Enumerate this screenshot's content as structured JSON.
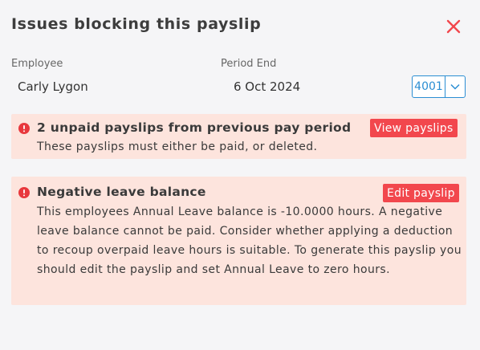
{
  "dialog": {
    "title": "Issues blocking this payslip"
  },
  "fields": {
    "employee_label": "Employee",
    "employee_value": "Carly Lygon",
    "period_end_label": "Period End",
    "period_end_value": "6 Oct 2024",
    "code_value": "4001"
  },
  "issues": [
    {
      "title": "2  unpaid payslips from previous pay period",
      "description": "These payslips must either be paid, or deleted.",
      "action_label": "View payslips"
    },
    {
      "title": "Negative leave balance",
      "description": "This employees Annual Leave balance is -10.0000 hours. A negative leave balance cannot be paid. Consider whether applying a deduction to recoup overpaid leave hours is suitable. To generate this payslip you should edit the payslip and set Annual Leave to zero hours.",
      "action_label": "Edit payslip"
    }
  ],
  "colors": {
    "accent": "#2b8ed3",
    "alert_bg": "#fde4dd",
    "danger": "#f2474d",
    "background": "#f5f5f7"
  },
  "icons": {
    "close": "close-icon",
    "error": "error-icon",
    "dropdown": "chevron-down-icon"
  }
}
